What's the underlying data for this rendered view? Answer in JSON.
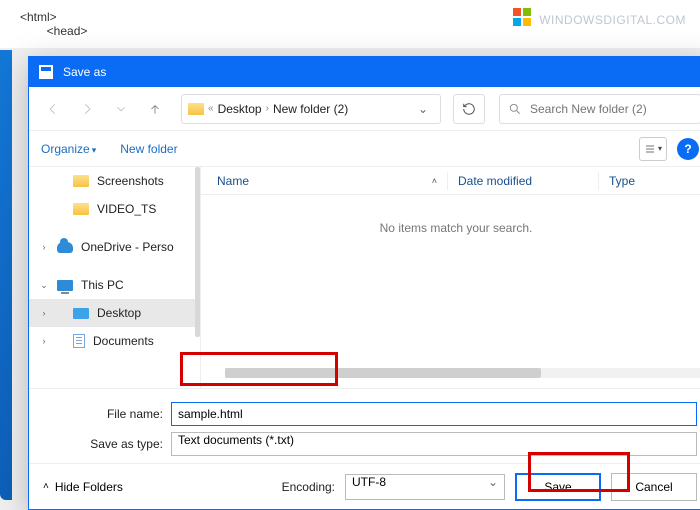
{
  "watermark": "WINDOWSDIGITAL.COM",
  "code": {
    "l1": "<html>",
    "l2": "        <head>"
  },
  "dialog": {
    "title": "Save as",
    "breadcrumb": {
      "seg1": "Desktop",
      "seg2": "New folder (2)"
    },
    "search": {
      "placeholder": "Search New folder (2)"
    },
    "toolbar": {
      "organize": "Organize",
      "newfolder": "New folder"
    },
    "columns": {
      "name": "Name",
      "date": "Date modified",
      "type": "Type"
    },
    "empty_msg": "No items match your search.",
    "filename_label": "File name:",
    "filename_value": "sample.html",
    "type_label": "Save as type:",
    "type_value": "Text documents (*.txt)",
    "encoding_label": "Encoding:",
    "encoding_value": "UTF-8",
    "hide_folders": "Hide Folders",
    "save": "Save",
    "cancel": "Cancel"
  },
  "tree": {
    "screenshots": "Screenshots",
    "video_ts": "VIDEO_TS",
    "onedrive": "OneDrive - Perso",
    "this_pc": "This PC",
    "desktop": "Desktop",
    "documents": "Documents"
  }
}
